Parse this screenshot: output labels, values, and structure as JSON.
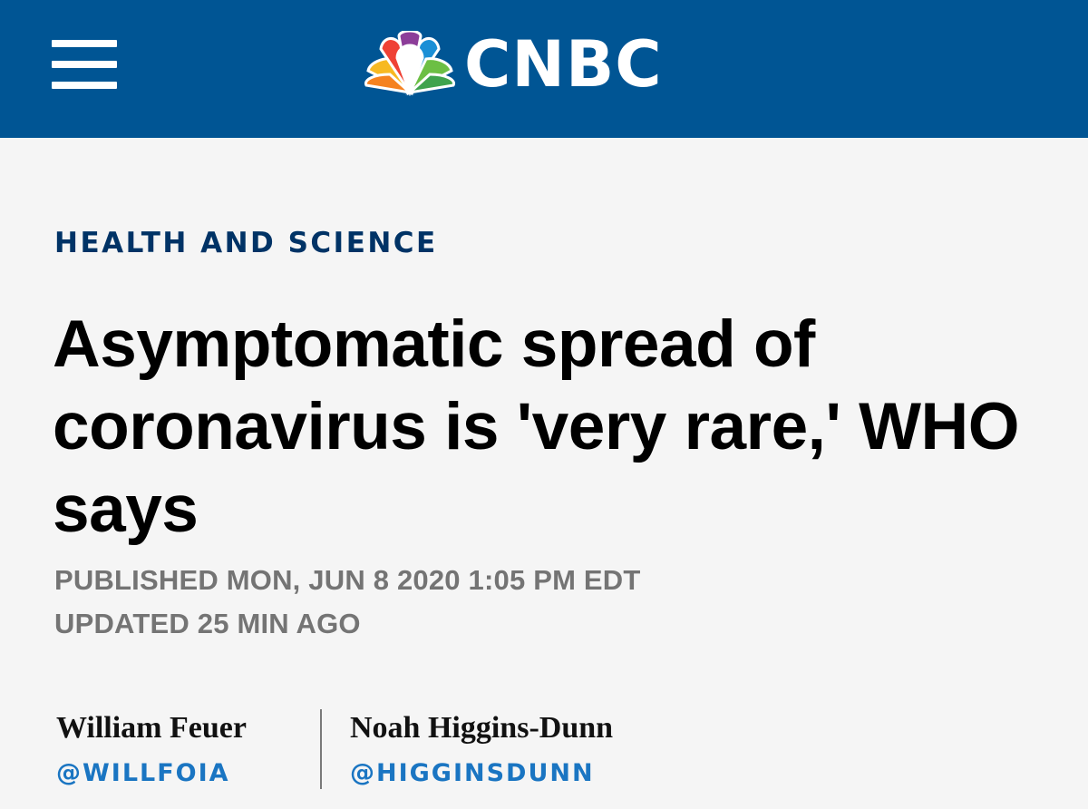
{
  "header": {
    "brand_name": "CNBC",
    "logo_icon": "nbc-peacock-icon",
    "menu_icon": "hamburger-menu-icon",
    "background_color": "#005594"
  },
  "article": {
    "section": "HEALTH AND SCIENCE",
    "headline": "Asymptomatic spread of coronavirus is 'very rare,' WHO says",
    "published": "PUBLISHED MON, JUN 8 2020 1:05 PM EDT",
    "updated": "UPDATED 25 MIN AGO",
    "authors": [
      {
        "name": "William Feuer",
        "handle": "@WILLFOIA"
      },
      {
        "name": "Noah Higgins-Dunn",
        "handle": "@HIGGINSDUNN"
      }
    ]
  },
  "colors": {
    "section": "#003366",
    "headline": "#000000",
    "meta": "#747474",
    "handle": "#1a75c2"
  }
}
